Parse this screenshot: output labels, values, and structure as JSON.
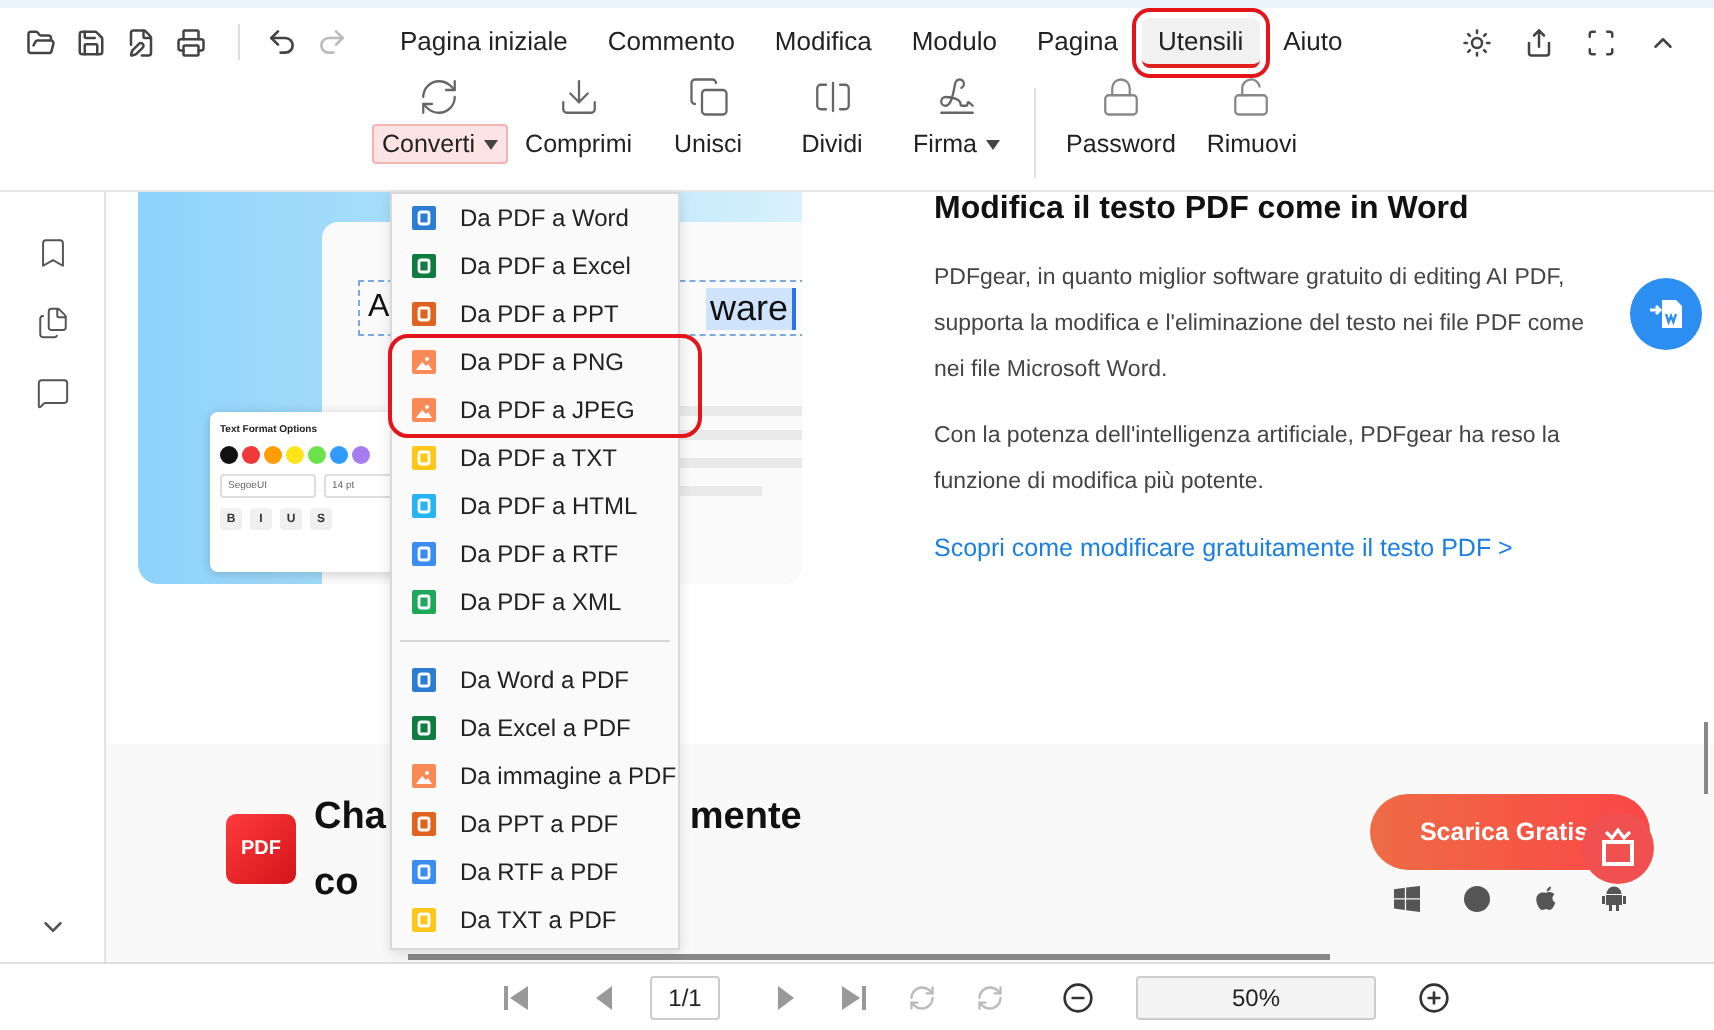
{
  "menu_tabs": [
    {
      "label": "Pagina iniziale",
      "selected": false,
      "highlighted": false
    },
    {
      "label": "Commento",
      "selected": false,
      "highlighted": false
    },
    {
      "label": "Modifica",
      "selected": false,
      "highlighted": false
    },
    {
      "label": "Modulo",
      "selected": false,
      "highlighted": false
    },
    {
      "label": "Pagina",
      "selected": false,
      "highlighted": false
    },
    {
      "label": "Utensili",
      "selected": true,
      "highlighted": true
    },
    {
      "label": "Aiuto",
      "selected": false,
      "highlighted": false
    }
  ],
  "ribbon_groups": [
    [
      {
        "label": "Converti",
        "kind": "dropdown",
        "open": true
      },
      {
        "label": "Comprimi",
        "kind": "button",
        "open": false
      },
      {
        "label": "Unisci",
        "kind": "button",
        "open": false
      },
      {
        "label": "Dividi",
        "kind": "button",
        "open": false
      },
      {
        "label": "Firma",
        "kind": "dropdown",
        "open": false
      }
    ],
    [
      {
        "label": "Password",
        "kind": "button",
        "open": false
      },
      {
        "label": "Rimuovi",
        "kind": "button",
        "open": false
      }
    ]
  ],
  "convert_menu": [
    [
      {
        "label": "Da PDF a Word",
        "kind": "word",
        "highlighted": false
      },
      {
        "label": "Da PDF a Excel",
        "kind": "excel",
        "highlighted": false
      },
      {
        "label": "Da PDF a PPT",
        "kind": "ppt",
        "highlighted": false
      },
      {
        "label": "Da PDF a PNG",
        "kind": "image",
        "highlighted": true
      },
      {
        "label": "Da PDF a JPEG",
        "kind": "image",
        "highlighted": true
      },
      {
        "label": "Da PDF a TXT",
        "kind": "txt",
        "highlighted": false
      },
      {
        "label": "Da PDF a HTML",
        "kind": "html",
        "highlighted": false
      },
      {
        "label": "Da PDF a RTF",
        "kind": "rtf",
        "highlighted": false
      },
      {
        "label": "Da PDF a XML",
        "kind": "xml",
        "highlighted": false
      }
    ],
    [
      {
        "label": "Da Word a PDF",
        "kind": "word",
        "highlighted": false
      },
      {
        "label": "Da Excel a PDF",
        "kind": "excel",
        "highlighted": false
      },
      {
        "label": "Da immagine a PDF",
        "kind": "image",
        "highlighted": false
      },
      {
        "label": "Da PPT a PDF",
        "kind": "ppt",
        "highlighted": false
      },
      {
        "label": "Da RTF a PDF",
        "kind": "rtf",
        "highlighted": false
      },
      {
        "label": "Da TXT a PDF",
        "kind": "txt",
        "highlighted": false
      }
    ]
  ],
  "document": {
    "illustration": {
      "text_start": "A",
      "text_end": "ware",
      "popup_title": "Text Format Options",
      "font_name": "SegoeUI",
      "font_size": "14 pt",
      "format_buttons": [
        "B",
        "I",
        "U",
        "S"
      ]
    },
    "heading": "Modifica il testo PDF come in Word",
    "paragraphs": [
      "PDFgear, in quanto miglior software gratuito di editing AI PDF, supporta la modifica e l'eliminazione del testo nei file PDF come nei file Microsoft Word.",
      "Con la potenza dell'intelligenza artificiale, PDFgear ha reso la funzione di modifica più potente."
    ],
    "link": "Scopri come modificare gratuitamente il testo PDF >",
    "download": {
      "logo_text": "PDF",
      "heading_line1_start": "Cha",
      "heading_line1_end": "mente",
      "heading_line2_start": "co",
      "button": "Scarica Gratis"
    }
  },
  "status_bar": {
    "page": "1/1",
    "zoom": "50%"
  }
}
